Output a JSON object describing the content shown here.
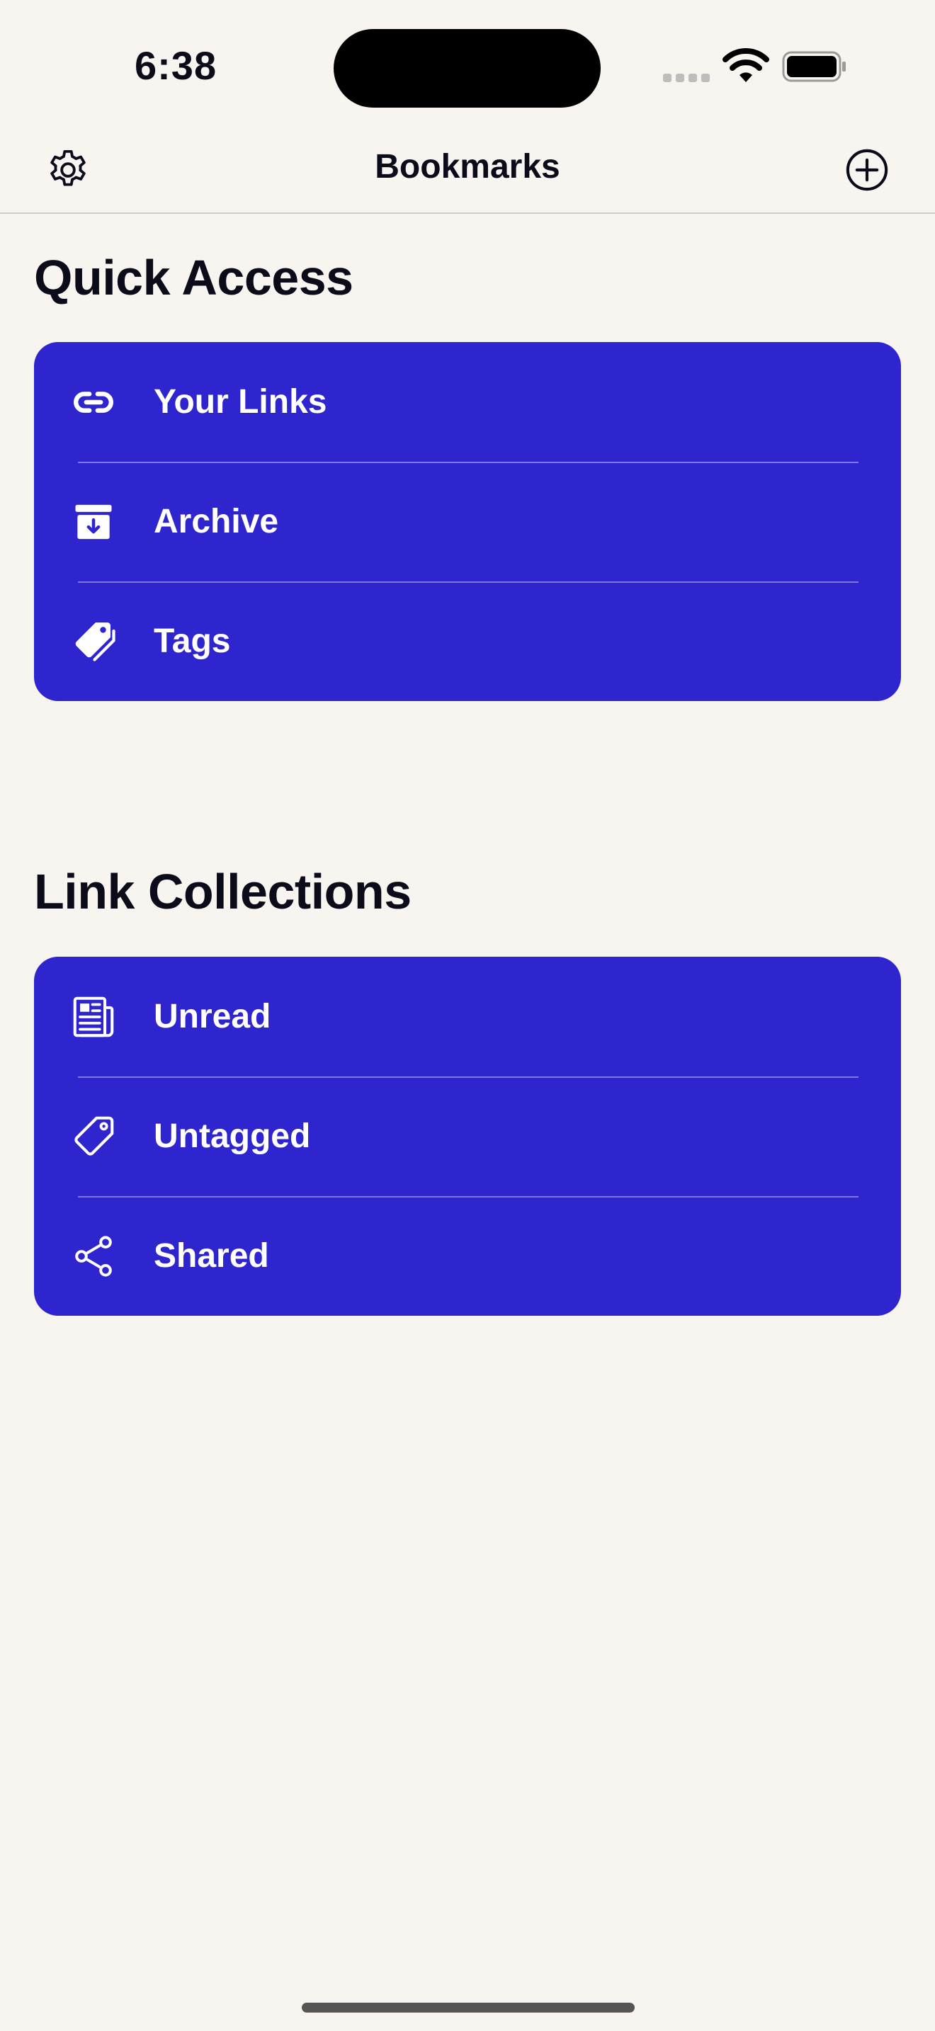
{
  "status": {
    "time": "6:38"
  },
  "header": {
    "title": "Bookmarks",
    "settings_icon": "gear-icon",
    "add_icon": "plus-circle-icon"
  },
  "sections": [
    {
      "title": "Quick Access",
      "items": [
        {
          "label": "Your Links",
          "icon": "link-icon"
        },
        {
          "label": "Archive",
          "icon": "archive-box-icon"
        },
        {
          "label": "Tags",
          "icon": "tags-icon"
        }
      ]
    },
    {
      "title": "Link Collections",
      "items": [
        {
          "label": "Unread",
          "icon": "newspaper-icon"
        },
        {
          "label": "Untagged",
          "icon": "tag-outline-icon"
        },
        {
          "label": "Shared",
          "icon": "share-icon"
        }
      ]
    }
  ],
  "colors": {
    "background": "#F8F5F0",
    "card": "#2F25CE",
    "text": "#0B0B1A"
  }
}
